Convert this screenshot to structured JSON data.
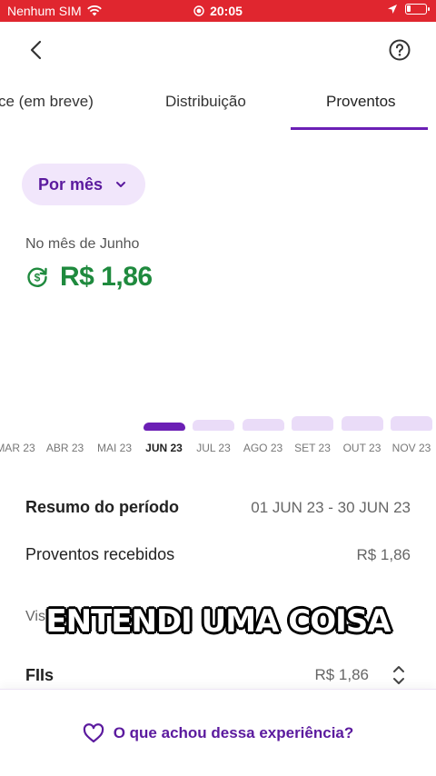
{
  "status_bar": {
    "carrier": "Nenhum SIM",
    "time": "20:05"
  },
  "tabs": [
    {
      "label": "ce (em breve)"
    },
    {
      "label": "Distribuição"
    },
    {
      "label": "Proventos",
      "active": true
    }
  ],
  "filter": {
    "label": "Por mês"
  },
  "summary": {
    "month_label": "No mês de Junho",
    "amount": "R$ 1,86",
    "amount_color": "#1f8a3e"
  },
  "chart_data": {
    "type": "bar",
    "categories": [
      "MAR 23",
      "ABR 23",
      "MAI 23",
      "JUN 23",
      "JUL 23",
      "AGO 23",
      "SET 23",
      "OUT 23",
      "NOV 23"
    ],
    "selected": "JUN 23",
    "values": [
      0,
      0,
      0,
      1.86,
      1.86,
      2.0,
      3.0,
      3.0,
      3.0
    ],
    "active_color": "#6b1fb5",
    "inactive_color": "#eadcf8"
  },
  "period": {
    "label": "Resumo do período",
    "value": "01 JUN 23 - 30 JUN 23"
  },
  "received": {
    "label": "Proventos recebidos",
    "value": "R$ 1,86"
  },
  "visualize": {
    "label": "Visualiz"
  },
  "caption": "ENTENDI UMA COISA",
  "fii": {
    "label": "FIIs",
    "value": "R$ 1,86"
  },
  "feedback": {
    "label": "O que achou dessa experiência?"
  },
  "colors": {
    "brand_purple": "#6b1fb5",
    "status_red": "#e0262f"
  }
}
